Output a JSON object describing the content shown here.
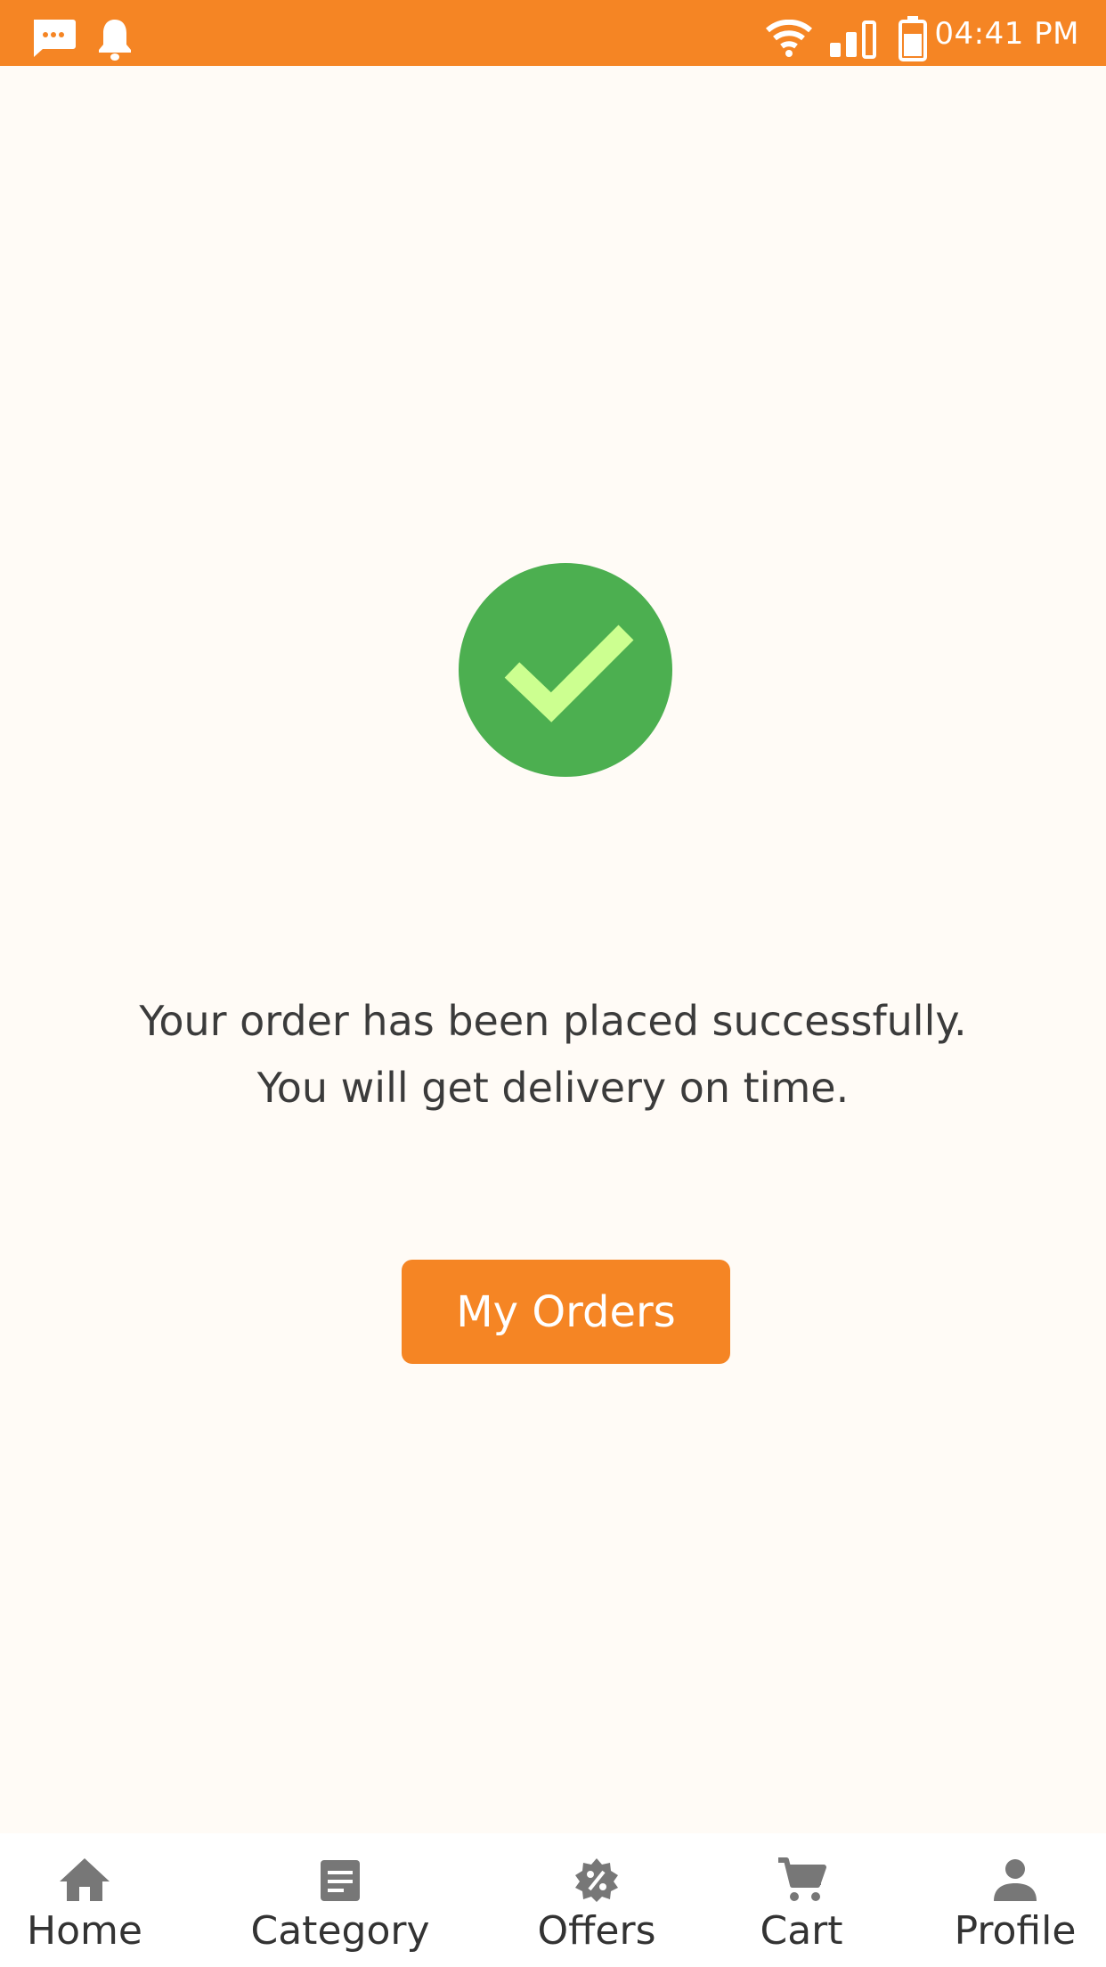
{
  "status_bar": {
    "time": "04:41 PM",
    "icons": [
      "message-icon",
      "notification-bell-icon",
      "wifi-icon",
      "signal-icon",
      "battery-icon"
    ],
    "background": "#f58524"
  },
  "main": {
    "success_icon": "check-circle-icon",
    "success_color": "#4caf50",
    "check_color": "#ccff90",
    "message_line1": "Your order has been placed successfully.",
    "message_line2": "You will get delivery on time.",
    "my_orders_label": "My Orders",
    "accent": "#f58524"
  },
  "bottom_nav": {
    "items": [
      {
        "label": "Home",
        "icon": "home-icon"
      },
      {
        "label": "Category",
        "icon": "category-icon"
      },
      {
        "label": "Offers",
        "icon": "offers-icon"
      },
      {
        "label": "Cart",
        "icon": "cart-icon"
      },
      {
        "label": "Profile",
        "icon": "profile-icon"
      }
    ]
  }
}
